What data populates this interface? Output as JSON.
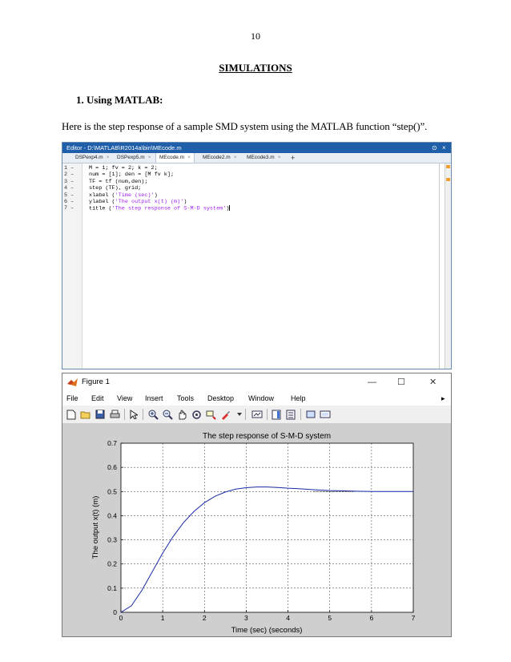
{
  "page": {
    "number": "10",
    "heading": "SIMULATIONS",
    "subheading": "1.  Using MATLAB:",
    "paragraph": "Here is the step response of a sample SMD system using the MATLAB function “step()”."
  },
  "editor": {
    "title": "Editor - D:\\MATLAB\\R2014a\\bin\\MEcode.m",
    "tabs": [
      {
        "label": "DSPexp4.m",
        "active": false
      },
      {
        "label": "DSPexp5.m",
        "active": false
      },
      {
        "label": "MEcode.m",
        "active": true
      },
      {
        "label": "MEcode2.m",
        "active": false
      },
      {
        "label": "MEcode3.m",
        "active": false
      }
    ],
    "tab_close": "×",
    "tab_add": "+",
    "lines": [
      {
        "num": "1 –",
        "code": "M = 1; fv = 2; k = 2;"
      },
      {
        "num": "2 –",
        "code": "num = [1]; den = [M fv k];"
      },
      {
        "num": "3 –",
        "code": "TF = tf (num,den);"
      },
      {
        "num": "4 –",
        "code": "step (TF), grid;"
      },
      {
        "num": "5 –",
        "code_pre": "xlabel (",
        "code_str": "'Time (sec)'",
        "code_post": ")"
      },
      {
        "num": "6 –",
        "code_pre": "ylabel (",
        "code_str": "'The output x(t) (m)'",
        "code_post": ")"
      },
      {
        "num": "7 –",
        "code_pre": "title (",
        "code_str": "'The step response of S-M-D system'",
        "code_post": ")"
      }
    ]
  },
  "figure": {
    "title": "Figure 1",
    "menus": [
      "File",
      "Edit",
      "View",
      "Insert",
      "Tools",
      "Desktop",
      "Window",
      "Help"
    ],
    "menu_arrow": "▸",
    "window_controls": {
      "minimize": "—",
      "maximize": "☐",
      "close": "✕"
    },
    "toolbar_icons": [
      "new-figure-icon",
      "open-file-icon",
      "save-icon",
      "print-icon",
      "pointer-icon",
      "zoom-in-icon",
      "zoom-out-icon",
      "pan-icon",
      "rotate-icon",
      "data-cursor-icon",
      "brush-icon",
      "link-icon",
      "colorbar-icon",
      "legend-icon",
      "hide-plot-tools-icon",
      "show-plot-tools-icon"
    ]
  },
  "chart_data": {
    "type": "line",
    "title": "The step response of S-M-D system",
    "xlabel": "Time (sec) (seconds)",
    "ylabel": "The output x(t) (m)",
    "xlim": [
      0,
      7
    ],
    "ylim": [
      0,
      0.7
    ],
    "xticks": [
      "0",
      "1",
      "2",
      "3",
      "4",
      "5",
      "6",
      "7"
    ],
    "yticks": [
      "0",
      "0.1",
      "0.2",
      "0.3",
      "0.4",
      "0.5",
      "0.6",
      "0.7"
    ],
    "grid": true,
    "series": [
      {
        "color": "#1a2aa8",
        "x": [
          0,
          0.25,
          0.5,
          0.75,
          1.0,
          1.25,
          1.5,
          1.75,
          2.0,
          2.25,
          2.5,
          2.75,
          3.0,
          3.25,
          3.5,
          3.75,
          4.0,
          4.25,
          4.5,
          4.75,
          5.0,
          5.25,
          5.5,
          6.0,
          6.5,
          7.0
        ],
        "y": [
          0,
          0.027,
          0.091,
          0.168,
          0.245,
          0.314,
          0.372,
          0.418,
          0.454,
          0.48,
          0.498,
          0.51,
          0.516,
          0.519,
          0.519,
          0.517,
          0.514,
          0.512,
          0.509,
          0.506,
          0.504,
          0.503,
          0.502,
          0.5,
          0.5,
          0.5
        ]
      }
    ],
    "final_value_line": {
      "y": 0.5,
      "x_from": 4.6,
      "x_to": 5.6,
      "style": "dotted"
    }
  }
}
